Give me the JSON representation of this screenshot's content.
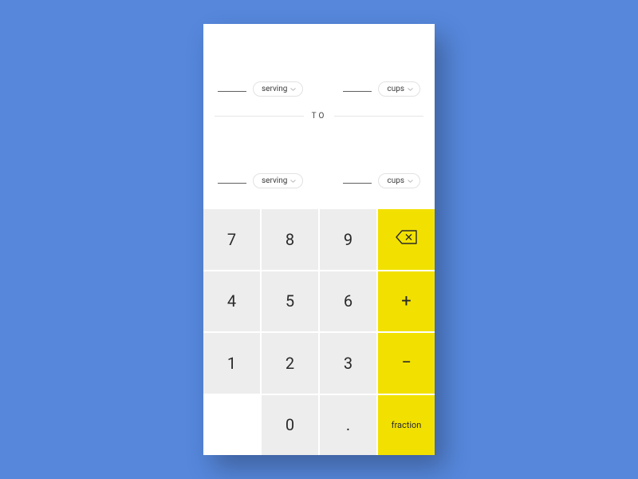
{
  "converter": {
    "from": {
      "serving_label": "serving",
      "amount_label": "cups"
    },
    "to_label": "TO",
    "to": {
      "serving_label": "serving",
      "amount_label": "cups"
    }
  },
  "keypad": {
    "k7": "7",
    "k8": "8",
    "k9": "9",
    "k4": "4",
    "k5": "5",
    "k6": "6",
    "k1": "1",
    "k2": "2",
    "k3": "3",
    "k0": "0",
    "dot": ".",
    "plus": "+",
    "minus": "−",
    "fraction": "fraction"
  },
  "colors": {
    "background": "#5687db",
    "accent": "#f2e100",
    "key": "#ededed"
  }
}
